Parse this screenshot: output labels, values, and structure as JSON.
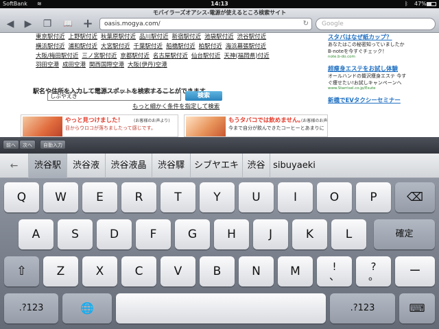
{
  "status_bar": {
    "carrier": "SoftBank",
    "wifi_icon": "wifi-icon",
    "time": "14:13",
    "bluetooth_icon": "bluetooth-icon",
    "battery_text": "47%",
    "battery_level": 0.47
  },
  "browser": {
    "page_title": "モバイラーズオアシス-電源が使えるところ検索サイト",
    "back_icon": "◀",
    "forward_icon": "▶",
    "tabs_icon": "❐",
    "bookmarks_icon": "📖",
    "add_icon": "+",
    "url": "oasis.mogya.com/",
    "reload_icon": "↻",
    "search_placeholder": "Google"
  },
  "page": {
    "stations": [
      "東京駅付近",
      "上野駅付近",
      "秋葉原駅付近",
      "品川駅付近",
      "新宿駅付近",
      "池袋駅付近",
      "渋谷駅付近",
      "横浜駅付近",
      "浦和駅付近",
      "大宮駅付近",
      "千葉駅付近",
      "船橋駅付近",
      "柏駅付近",
      "海浜幕張駅付近",
      "大阪/梅田駅付近",
      "三ノ宮駅付近",
      "京都駅付近",
      "名古屋駅付近",
      "仙台駅付近",
      "天神(福岡県)付近",
      "羽田空港",
      "成田空港",
      "関西国際空港",
      "大阪(伊丹)空港"
    ],
    "search_label": "駅名や住所を入力して電源スポットを検索することができます",
    "search_value": "しぶやえき",
    "search_button": "検索",
    "detail_link": "もっと細かく条件を指定して検索",
    "banners": [
      {
        "title": "やっと見つけました！",
        "note": "(お客様のお声より)",
        "sub": "目からウロコが落ちましたって感じです。"
      },
      {
        "title": "もうタバコでは飲めません。",
        "note": "(お客様のお声より)",
        "sub": "今まで自分が飲んできたコーヒーとあまりに"
      }
    ],
    "sidebar": {
      "ad1_head": "スタバはなぜ紙カップ？",
      "ad1_body": "あなたはこの秘密知っていましたか B-noteを今すぐチェック！",
      "ad1_url": "note.b-do.com",
      "ad2_head": "超痩身エステをお試し体験",
      "ad2_body": "オールハンドの贅沢痩身エステ 今すぐ痩せたい!お試しキャンペーンへ",
      "ad2_url": "www.Starrisel.co.jp/Esute",
      "ad3_head": "新橋でEVタクシーセミナー"
    }
  },
  "accessory": {
    "prev": "前へ",
    "next": "次へ",
    "autofill": "自動入力"
  },
  "candidates": {
    "back": "←",
    "items": [
      "渋谷駅",
      "渋谷液",
      "渋谷液晶",
      "渋谷驛",
      "シブヤエキ",
      "渋谷",
      "sibuyaeki"
    ]
  },
  "keyboard": {
    "row1": [
      "Q",
      "W",
      "E",
      "R",
      "T",
      "Y",
      "U",
      "I",
      "O",
      "P"
    ],
    "row2": [
      "A",
      "S",
      "D",
      "F",
      "G",
      "H",
      "J",
      "K",
      "L"
    ],
    "row3": [
      "Z",
      "X",
      "C",
      "V",
      "B",
      "N",
      "M"
    ],
    "delete_icon": "⌫",
    "confirm": "確定",
    "shift_icon": "⇧",
    "comma_top": "!",
    "comma_bottom": "、",
    "period_top": "?",
    "period_bottom": "。",
    "dash": "ー",
    "numbers_left": ".?123",
    "globe_icon": "🌐",
    "space": "",
    "numbers_right": ".?123",
    "hide_icon": "⌨"
  }
}
